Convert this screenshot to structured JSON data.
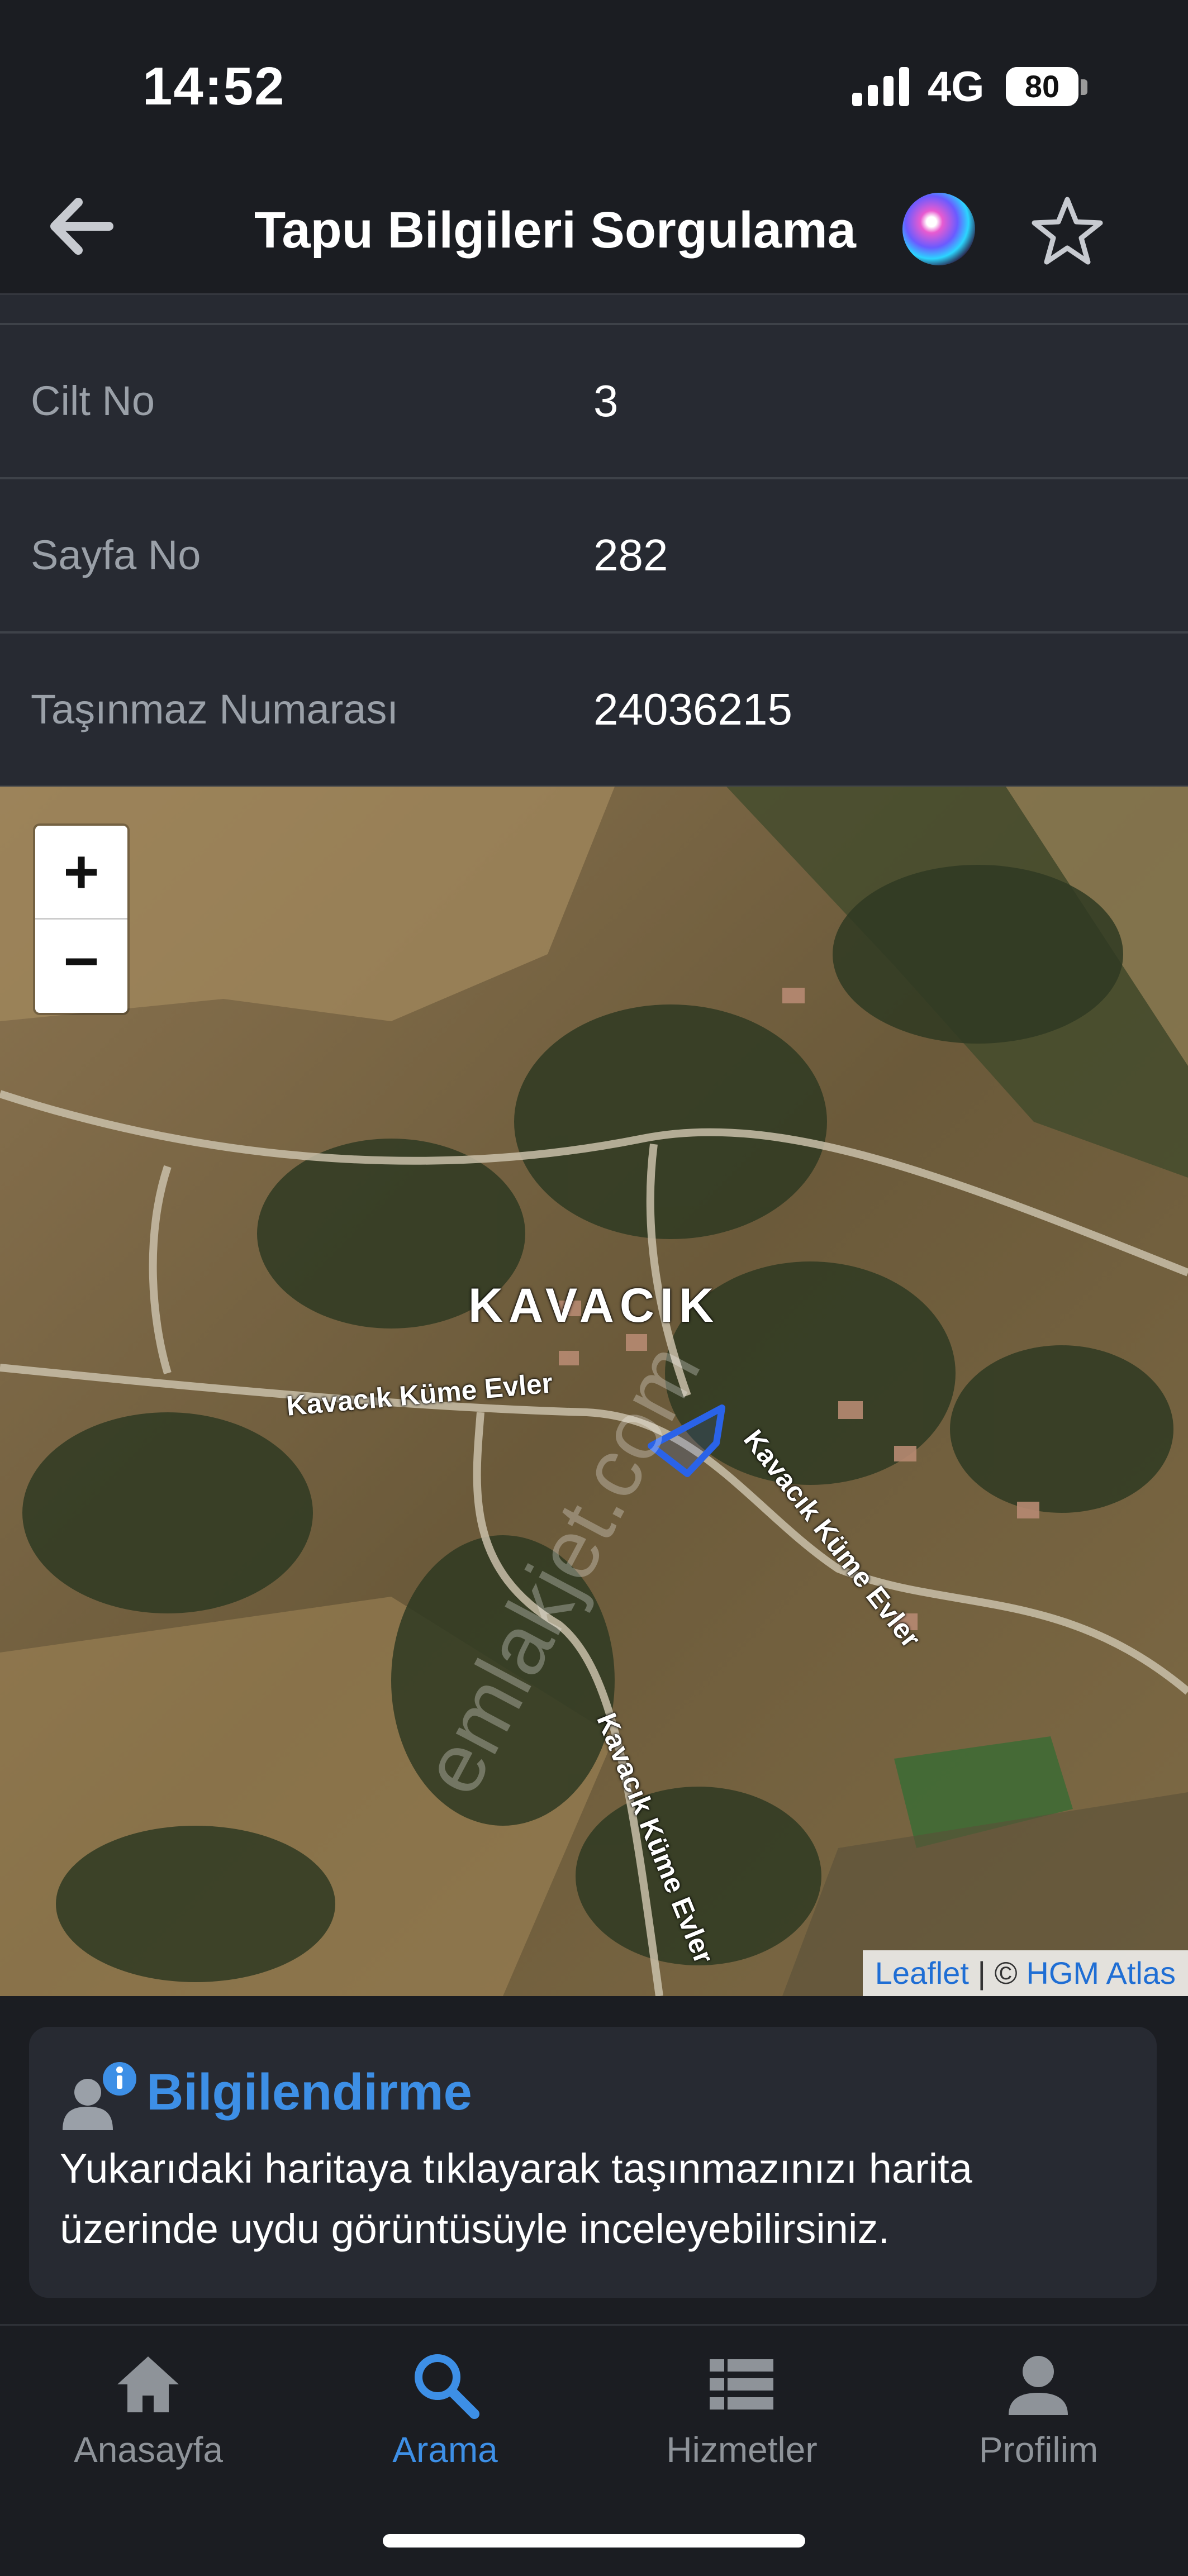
{
  "status_bar": {
    "time": "14:52",
    "network": "4G",
    "battery_level": "80",
    "battery_fraction": 0.8
  },
  "header": {
    "title": "Tapu Bilgileri Sorgulama",
    "back_icon": "arrow-left-icon",
    "assistant_icon": "siri-icon",
    "favorite_icon": "star-outline-icon"
  },
  "info_rows": [
    {
      "label": "Cilt No",
      "value": "3"
    },
    {
      "label": "Sayfa No",
      "value": "282"
    },
    {
      "label": "Taşınmaz Numarası",
      "value": "24036215"
    }
  ],
  "map": {
    "zoom_in": "+",
    "zoom_out": "−",
    "place_label": "KAVACIK",
    "road_labels": [
      "Kavacık Küme Evler",
      "Kavacık Küme Evler",
      "Kavacık Küme Evler"
    ],
    "watermark": "emlakjet.com",
    "attribution": {
      "link1": "Leaflet",
      "separator": " | © ",
      "link2": "HGM Atlas"
    },
    "parcel_color": "#2a63e8"
  },
  "info_card": {
    "title": "Bilgilendirme",
    "text": "Yukarıdaki haritaya tıklayarak taşınmazınızı harita üzerinde uydu görüntüsüyle inceleyebilirsiniz.",
    "icon": "user-info-icon"
  },
  "tabs": [
    {
      "label": "Anasayfa",
      "icon": "home-icon",
      "active": false
    },
    {
      "label": "Arama",
      "icon": "search-icon",
      "active": true
    },
    {
      "label": "Hizmetler",
      "icon": "list-icon",
      "active": false
    },
    {
      "label": "Profilim",
      "icon": "person-icon",
      "active": false
    }
  ],
  "colors": {
    "background": "#1b1d22",
    "row_background": "#272a32",
    "accent": "#3d8fe6",
    "muted_text": "#9aa0a8"
  }
}
